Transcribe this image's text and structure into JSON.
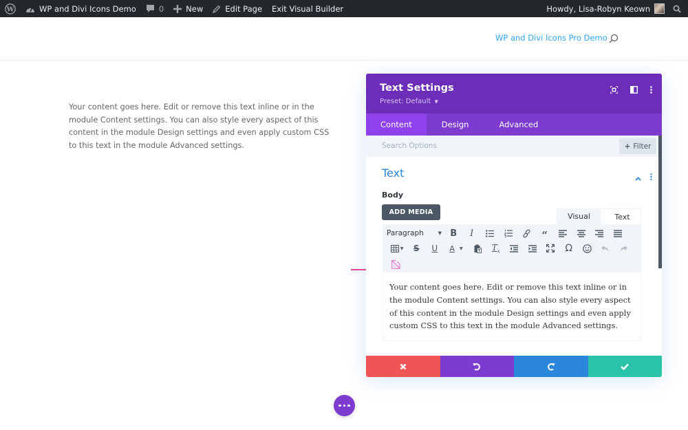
{
  "admin_bar": {
    "site_name": "WP and Divi Icons Demo",
    "comments_count": "0",
    "new_label": "New",
    "edit_page_label": "Edit Page",
    "exit_builder_label": "Exit Visual Builder",
    "greeting": "Howdy, Lisa-Robyn Keown"
  },
  "header": {
    "nav_link": "WP and Divi Icons Pro Demo"
  },
  "page": {
    "body_text": "Your content goes here. Edit or remove this text inline or in the module Content settings. You can also style every aspect of this content in the module Design settings and even apply custom CSS to this text in the module Advanced settings."
  },
  "modal": {
    "title": "Text Settings",
    "preset": "Preset: Default",
    "tabs": [
      {
        "label": "Content",
        "active": true
      },
      {
        "label": "Design",
        "active": false
      },
      {
        "label": "Advanced",
        "active": false
      }
    ],
    "search_placeholder": "Search Options",
    "filter_label": "Filter",
    "section_title": "Text",
    "body_label": "Body",
    "add_media_label": "ADD MEDIA",
    "editor_tabs": {
      "visual": "Visual",
      "text": "Text"
    },
    "toolbar": {
      "format_select": "Paragraph",
      "row1": [
        "bold",
        "italic",
        "bullet-list",
        "numbered-list",
        "link",
        "blockquote",
        "align-left",
        "align-center",
        "align-right",
        "align-justify"
      ],
      "row2": [
        "table",
        "strikethrough",
        "underline",
        "text-color",
        "paste-as-text",
        "clear-formatting",
        "outdent",
        "indent",
        "fullscreen",
        "special-character",
        "emoticons",
        "undo",
        "redo"
      ],
      "row3": [
        "divi-icons"
      ]
    },
    "editor_content": "Your content goes here. Edit or remove this text inline or in the module Content settings. You can also style every aspect of this content in the module Design settings and even apply custom CSS to this text in the module Advanced settings.",
    "footer_buttons": [
      "cancel",
      "undo",
      "redo",
      "save"
    ]
  },
  "colors": {
    "admin_bar": "#23282d",
    "modal_header": "#6c2eb9",
    "modal_tabs": "#7e3bd0",
    "active_tab": "#8f42ec",
    "accent_blue": "#2b87da",
    "link_blue": "#2ea3f2",
    "cancel": "#ef5555",
    "save": "#29c4a9",
    "annotation_arrow": "#e6238f",
    "divi_icon": "#e879d8"
  }
}
